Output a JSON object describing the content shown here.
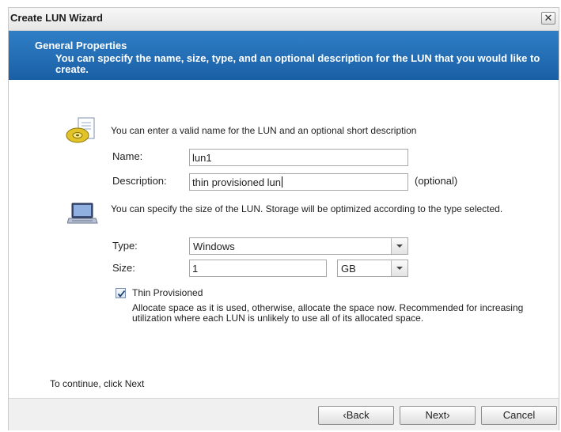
{
  "window": {
    "title": "Create LUN Wizard",
    "close_glyph": "✕"
  },
  "banner": {
    "heading": "General Properties",
    "description": "You can specify the name, size, type, and an optional description for the LUN that you would like to create."
  },
  "name_section": {
    "icon": "disk-document-icon",
    "instruction": "You can enter a valid name for the LUN and an optional short description",
    "name_label": "Name:",
    "name_value": "lun1",
    "description_label": "Description:",
    "description_value": "thin provisioned lun",
    "optional_hint": "(optional)"
  },
  "size_section": {
    "icon": "laptop-icon",
    "instruction": "You can specify the size of the LUN. Storage will be optimized according to the type selected.",
    "type_label": "Type:",
    "type_value": "Windows",
    "size_label": "Size:",
    "size_value": "1",
    "unit_value": "GB"
  },
  "thin": {
    "checked": true,
    "label": "Thin Provisioned",
    "note": "Allocate space as it is used, otherwise, allocate the space now. Recommended for increasing utilization where each LUN is unlikely to use all of its allocated space."
  },
  "footer_hint": "To continue, click Next",
  "buttons": {
    "back": "‹Back",
    "next": "Next›",
    "cancel": "Cancel"
  },
  "colors": {
    "banner": "#1f67ae",
    "banner_text": "#ffffff"
  }
}
